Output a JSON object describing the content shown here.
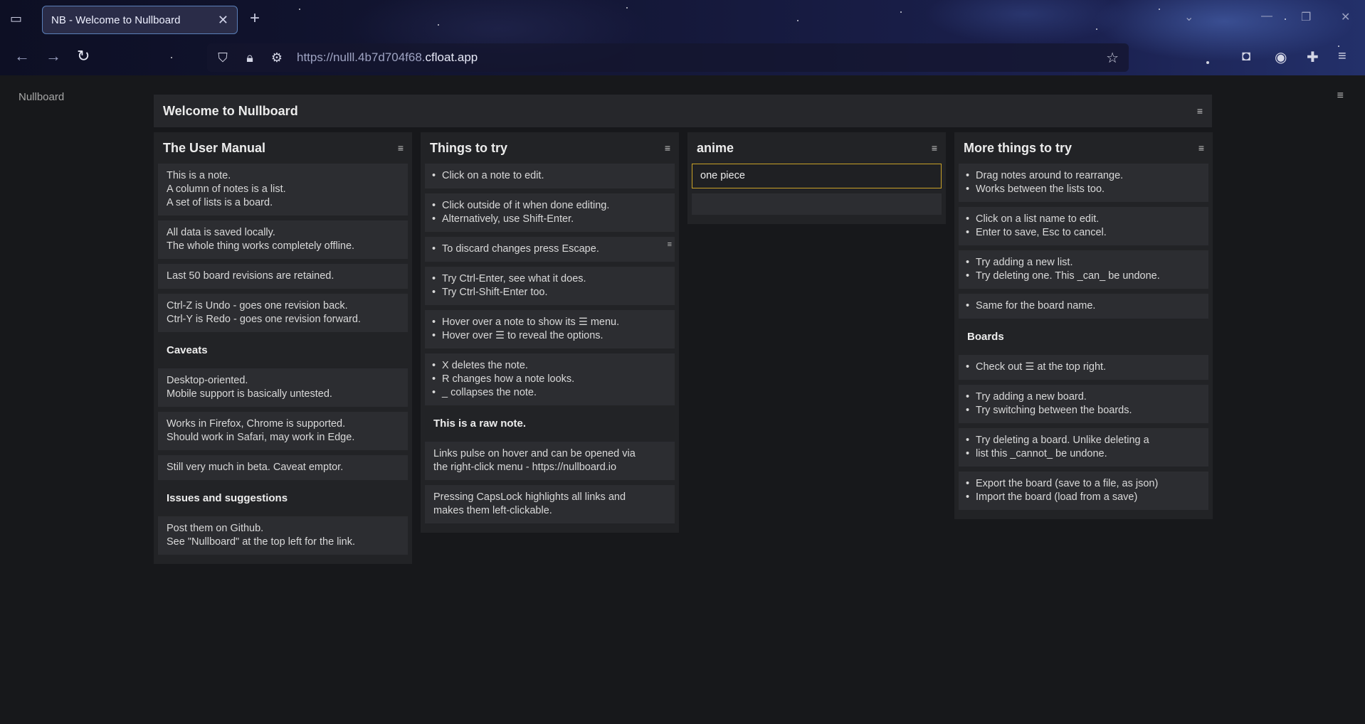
{
  "browser": {
    "tab_title": "NB - Welcome to Nullboard",
    "url_prefix": "https://nulll.4b7d704f68.",
    "url_domain": "cfloat.app"
  },
  "app": {
    "brand": "Nullboard",
    "board_title": "Welcome to Nullboard",
    "menu_glyph": "≡"
  },
  "lists": [
    {
      "name": "The User Manual",
      "notes": [
        {
          "type": "note",
          "lines": [
            "This is a note.",
            "A column of notes is a list.",
            "A set of lists is a board."
          ]
        },
        {
          "type": "note",
          "lines": [
            "All data is saved locally.",
            "The whole thing works completely offline."
          ]
        },
        {
          "type": "note",
          "lines": [
            "Last 50 board revisions are retained."
          ]
        },
        {
          "type": "note",
          "lines": [
            "Ctrl-Z is Undo  -  goes one revision back.",
            "Ctrl-Y is Redo  -  goes one revision forward."
          ]
        },
        {
          "type": "raw",
          "lines": [
            "Caveats"
          ]
        },
        {
          "type": "note",
          "lines": [
            "Desktop-oriented.",
            "Mobile support is basically untested."
          ]
        },
        {
          "type": "note",
          "lines": [
            "Works in Firefox, Chrome is supported.",
            "Should work in Safari, may work in Edge."
          ]
        },
        {
          "type": "note",
          "lines": [
            "Still very much in beta. Caveat emptor."
          ]
        },
        {
          "type": "raw",
          "lines": [
            "Issues and suggestions"
          ]
        },
        {
          "type": "note",
          "lines": [
            "Post them on Github.",
            "See \"Nullboard\" at the top left for the link."
          ]
        }
      ]
    },
    {
      "name": "Things to try",
      "notes": [
        {
          "type": "bul",
          "lines": [
            "Click on a note to edit."
          ]
        },
        {
          "type": "bul",
          "lines": [
            "Click outside of it when done editing.",
            "Alternatively, use Shift-Enter."
          ]
        },
        {
          "type": "bul",
          "lines": [
            "To discard changes press Escape."
          ],
          "hover": true
        },
        {
          "type": "bul",
          "lines": [
            "Try Ctrl-Enter, see what it does.",
            "Try Ctrl-Shift-Enter too."
          ]
        },
        {
          "type": "bul",
          "lines": [
            "Hover over a note to show its  ☰  menu.",
            "Hover over  ☰  to reveal the options."
          ]
        },
        {
          "type": "bul",
          "lines": [
            "X  deletes the note.",
            "R changes how a note looks.",
            "_  collapses the note."
          ]
        },
        {
          "type": "raw",
          "lines": [
            "This is a raw note."
          ]
        },
        {
          "type": "note",
          "lines": [
            "Links pulse on hover and can be opened via",
            "the right-click menu  -  https://nullboard.io"
          ]
        },
        {
          "type": "note",
          "lines": [
            "Pressing CapsLock highlights all links and",
            "makes them left-clickable."
          ]
        }
      ]
    },
    {
      "name": "anime",
      "notes": [
        {
          "type": "editing",
          "lines": [
            "one piece"
          ]
        },
        {
          "type": "empty",
          "lines": []
        }
      ]
    },
    {
      "name": "More things to try",
      "notes": [
        {
          "type": "bul",
          "lines": [
            "Drag notes around to rearrange.",
            "Works between the lists too."
          ]
        },
        {
          "type": "bul",
          "lines": [
            "Click on a list name to edit.",
            "Enter to save, Esc to cancel."
          ]
        },
        {
          "type": "bul",
          "lines": [
            "Try adding a new list.",
            "Try deleting one. This  _can_  be undone."
          ]
        },
        {
          "type": "bul",
          "lines": [
            "Same for the board name."
          ]
        },
        {
          "type": "raw",
          "lines": [
            "Boards"
          ]
        },
        {
          "type": "bul",
          "lines": [
            "Check out  ☰  at the top right."
          ]
        },
        {
          "type": "bul",
          "lines": [
            "Try adding a new board.",
            "Try switching between the boards."
          ]
        },
        {
          "type": "bul",
          "lines": [
            "Try deleting a board. Unlike deleting a",
            "list this  _cannot_  be undone."
          ]
        },
        {
          "type": "bul",
          "lines": [
            "Export the board  (save to a file, as json)",
            "Import the board  (load from a save)"
          ]
        }
      ]
    }
  ]
}
